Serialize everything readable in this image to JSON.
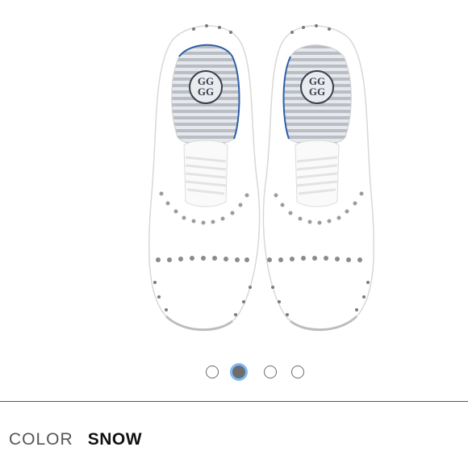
{
  "product": {
    "image_alt": "Pair of white studded golf shoes viewed from above",
    "logo_text": "G G G G"
  },
  "carousel": {
    "total": 4,
    "active_index": 1,
    "dot_labels": [
      "image-1",
      "image-2",
      "image-3",
      "image-4"
    ]
  },
  "color": {
    "label": "COLOR",
    "value": "SNOW"
  },
  "colors": {
    "active_dot": "#6d6d6d",
    "active_ring": "#7fb8f5",
    "divider": "#5a5a5a"
  }
}
